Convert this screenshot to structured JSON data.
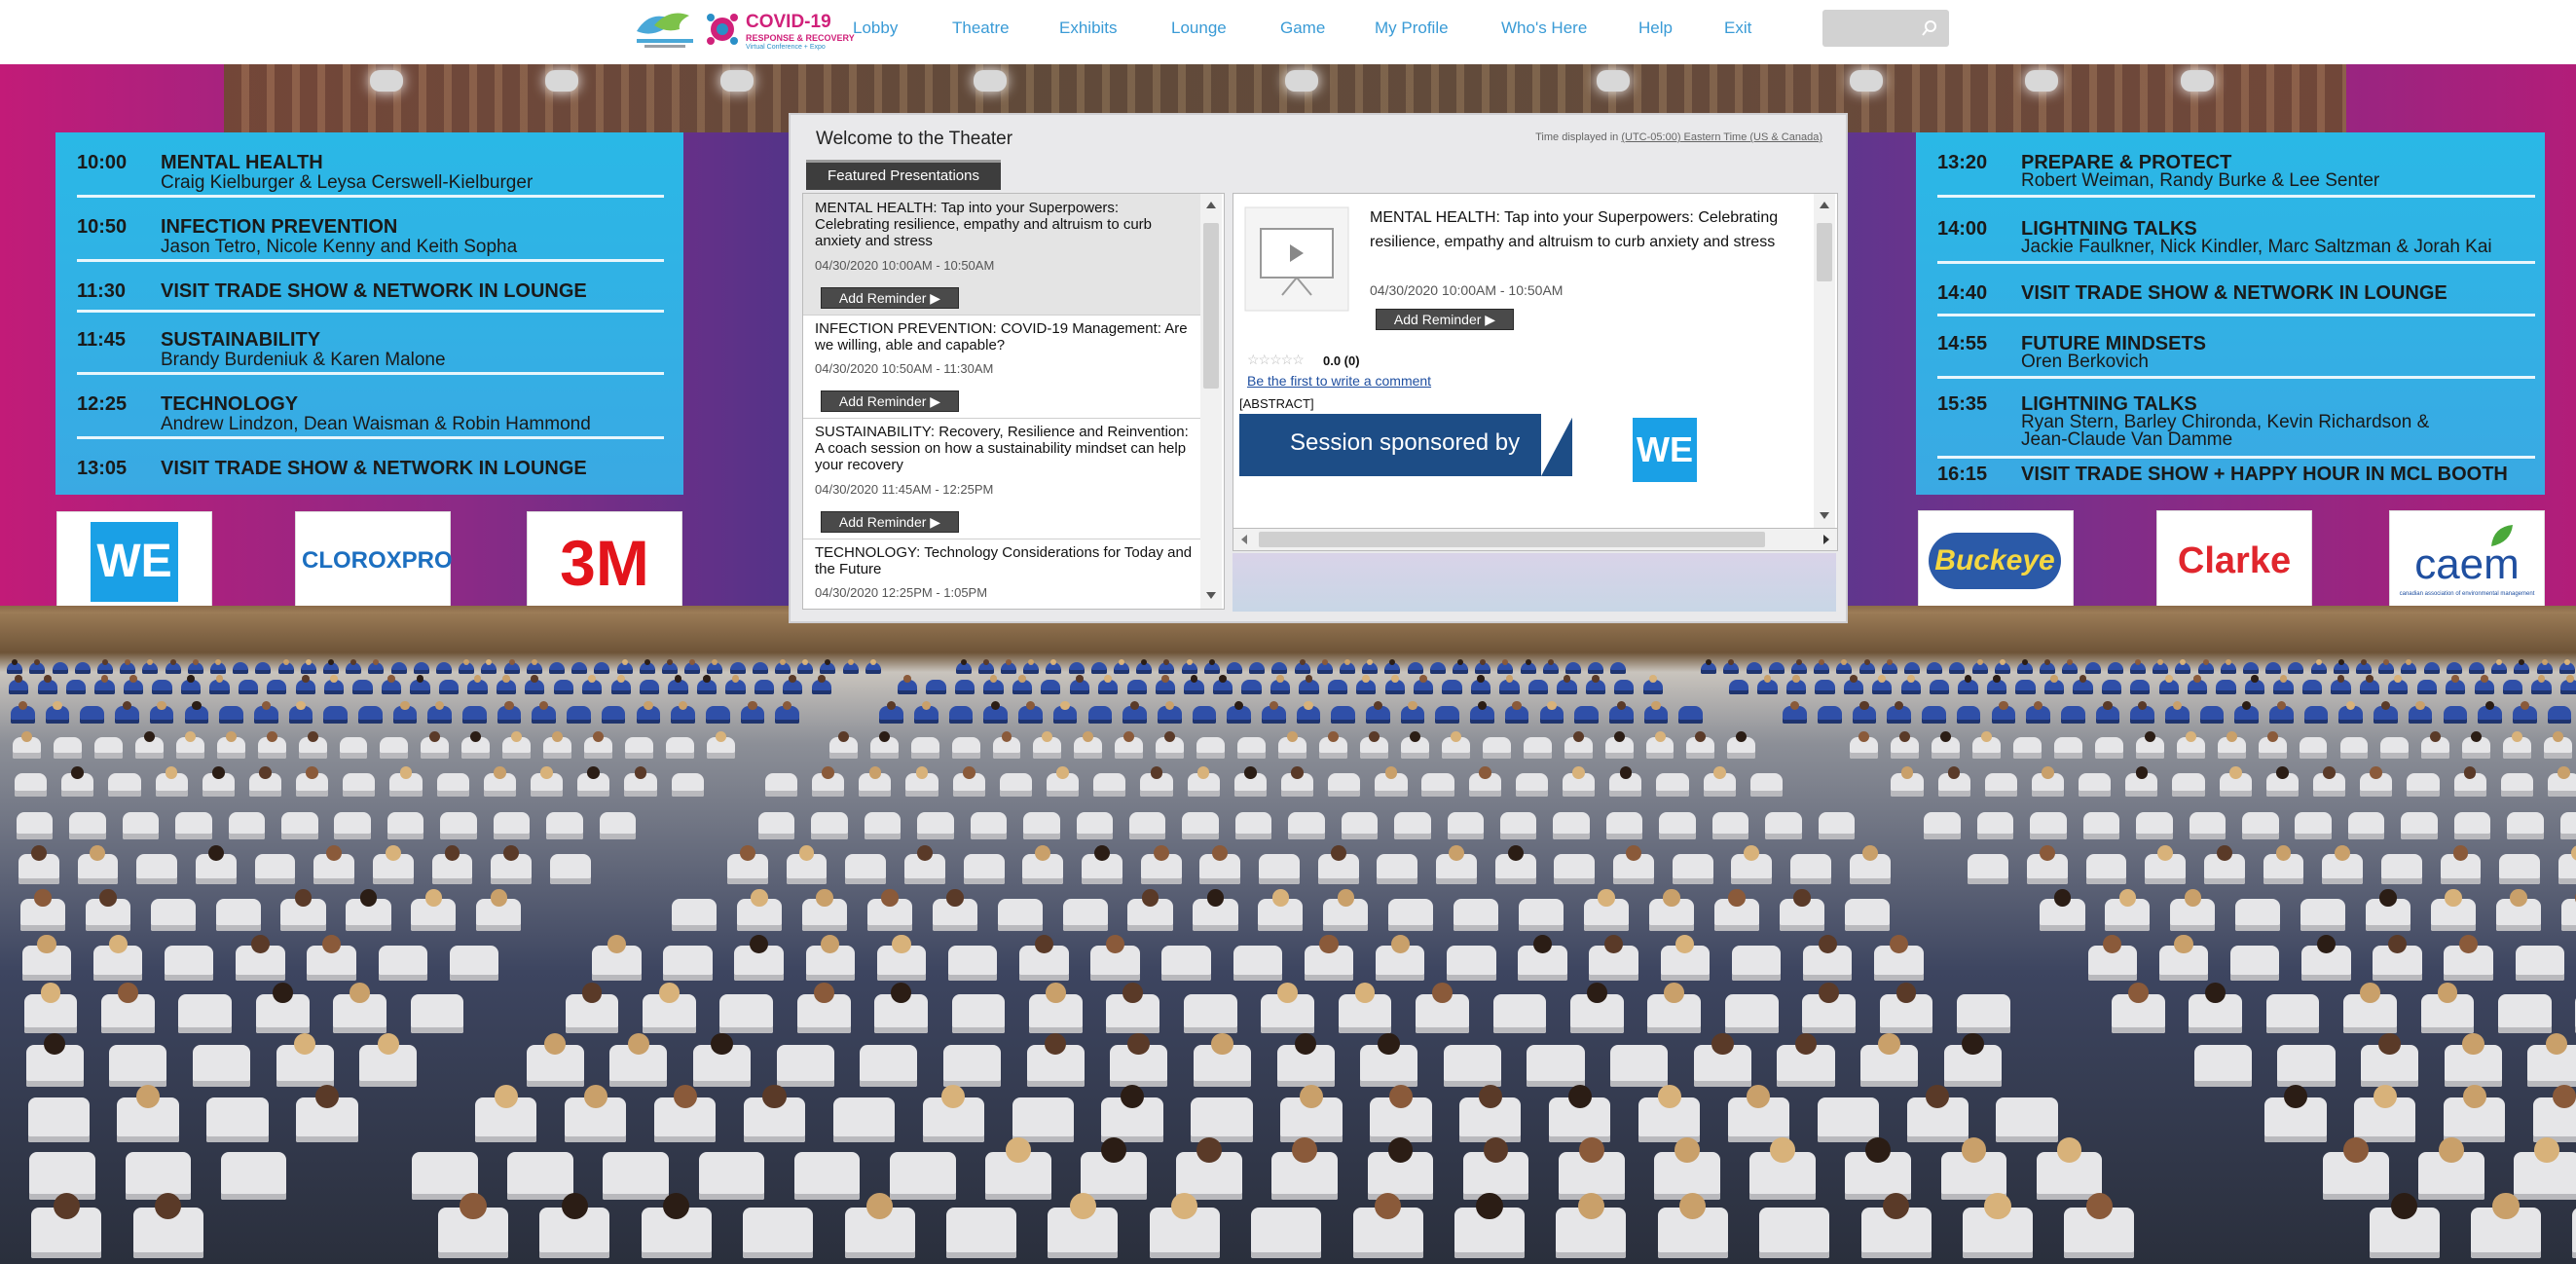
{
  "nav": {
    "logo_main": "COVID-19",
    "logo_sub": "RESPONSE & RECOVERY",
    "logo_tag": "Virtual Conference + Expo",
    "items": [
      "Lobby",
      "Theatre",
      "Exhibits",
      "Lounge",
      "Game",
      "My Profile",
      "Who's Here",
      "Help",
      "Exit"
    ],
    "search_placeholder": ""
  },
  "left_schedule": [
    {
      "time": "10:00",
      "title": "MENTAL HEALTH",
      "sub": "Craig Kielburger & Leysa Cerswell-Kielburger"
    },
    {
      "time": "10:50",
      "title": "INFECTION PREVENTION",
      "sub": "Jason Tetro, Nicole Kenny and Keith Sopha"
    },
    {
      "time": "11:30",
      "title": "VISIT TRADE SHOW & NETWORK IN LOUNGE",
      "sub": ""
    },
    {
      "time": "11:45",
      "title": "SUSTAINABILITY",
      "sub": "Brandy Burdeniuk & Karen Malone"
    },
    {
      "time": "12:25",
      "title": "TECHNOLOGY",
      "sub": "Andrew Lindzon, Dean Waisman & Robin Hammond"
    },
    {
      "time": "13:05",
      "title": "VISIT TRADE SHOW & NETWORK IN LOUNGE",
      "sub": ""
    }
  ],
  "right_schedule": [
    {
      "time": "13:20",
      "title": "PREPARE & PROTECT",
      "sub": "Robert Weiman, Randy Burke & Lee Senter"
    },
    {
      "time": "14:00",
      "title": "LIGHTNING TALKS",
      "sub": "Jackie Faulkner, Nick Kindler, Marc Saltzman & Jorah Kai"
    },
    {
      "time": "14:40",
      "title": "VISIT TRADE SHOW & NETWORK IN LOUNGE",
      "sub": ""
    },
    {
      "time": "14:55",
      "title": "FUTURE MINDSETS",
      "sub": "Oren Berkovich"
    },
    {
      "time": "15:35",
      "title": "LIGHTNING TALKS",
      "sub": "Ryan Stern, Barley Chironda, Kevin Richardson &",
      "sub2": "Jean-Claude Van Damme"
    },
    {
      "time": "16:15",
      "title": "VISIT TRADE SHOW + HAPPY HOUR IN MCL BOOTH",
      "sub": ""
    }
  ],
  "left_sponsors": [
    "WE",
    "CLOROXPRO",
    "3M"
  ],
  "right_sponsors": [
    "Buckeye",
    "Clarke",
    "caem"
  ],
  "right_sponsor_caem_tag": "canadian association of environmental management",
  "theater": {
    "title": "Welcome to the Theater",
    "tz_prefix": "Time displayed in",
    "tz_link": "(UTC-05:00) Eastern Time (US & Canada)",
    "tab": "Featured Presentations",
    "reminder_label": "Add Reminder ▶",
    "presentations": [
      {
        "title": "MENTAL HEALTH: Tap into your Superpowers: Celebrating resilience, empathy and altruism to curb anxiety and stress",
        "date": "04/30/2020 10:00AM - 10:50AM"
      },
      {
        "title": "INFECTION PREVENTION: COVID-19 Management: Are we willing, able and capable?",
        "date": "04/30/2020 10:50AM - 11:30AM"
      },
      {
        "title": "SUSTAINABILITY: Recovery, Resilience and Reinvention: A coach session on how a sustainability mindset can help your recovery",
        "date": "04/30/2020 11:45AM - 12:25PM"
      },
      {
        "title": "TECHNOLOGY: Technology Considerations for Today and the Future",
        "date": "04/30/2020 12:25PM - 1:05PM"
      }
    ],
    "detail": {
      "title": "MENTAL HEALTH: Tap into your Superpowers: Celebrating resilience, empathy and altruism to curb anxiety and stress",
      "date": "04/30/2020 10:00AM - 10:50AM",
      "rating": "0.0 (0)",
      "comment_link": "Be the first to write a comment",
      "abstract": "[ABSTRACT]",
      "sponsor_banner": "Session sponsored by",
      "sponsor_logo": "WE"
    }
  },
  "colors": {
    "accent": "#3a9bd6",
    "screen": "#2ab8e6",
    "we_blue": "#1aa0e6",
    "clorox_blue": "#1c6fc0",
    "red3m": "#e3141b",
    "clarke_red": "#e0262d",
    "buckeye_bg": "#2b5aa8",
    "buckeye_text": "#f4d742",
    "caem_blue": "#1f4fa0",
    "caem_green": "#4aa83a"
  }
}
